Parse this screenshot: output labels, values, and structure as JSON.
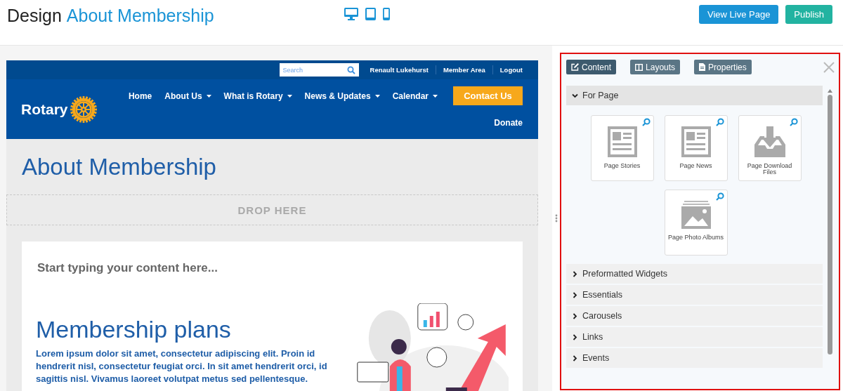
{
  "header": {
    "title_prefix": "Design",
    "title_page": "About Membership",
    "devices": [
      {
        "kind": "desktop"
      },
      {
        "kind": "tablet"
      },
      {
        "kind": "phone"
      }
    ],
    "buttons": [
      {
        "label": "View Live Page",
        "kind": "primary"
      },
      {
        "label": "Publish",
        "kind": "success"
      }
    ]
  },
  "preview": {
    "search": {
      "placeholder": "Search"
    },
    "top_links": [
      "Renault Lukehurst",
      "Member Area",
      "Logout"
    ],
    "logo": "Rotary",
    "nav": [
      {
        "label": "Home",
        "dropdown": false
      },
      {
        "label": "About Us",
        "dropdown": true
      },
      {
        "label": "What is Rotary",
        "dropdown": true
      },
      {
        "label": "News & Updates",
        "dropdown": true
      },
      {
        "label": "Calendar",
        "dropdown": true
      }
    ],
    "cta": "Contact Us",
    "donate": "Donate",
    "page_title": "About Membership",
    "drop_zone": "DROP HERE",
    "editor_placeholder": "Start typing your content here...",
    "heading": "Membership plans",
    "paragraph": "Lorem ipsum dolor sit amet, consectetur adipiscing elit. Proin id hendrerit nisl, consectetur feugiat orci. In sit amet hendrerit orci, id sagittis nisl. Vivamus laoreet volutpat metus sed pellentesque."
  },
  "panel": {
    "tabs": [
      {
        "label": "Content",
        "kind": "edit",
        "selected": true
      },
      {
        "label": "Layouts",
        "kind": "columns",
        "selected": false
      },
      {
        "label": "Properties",
        "kind": "file",
        "selected": false
      }
    ],
    "sections": [
      {
        "title": "For Page",
        "expanded": true,
        "widgets": [
          {
            "label": "Page Stories",
            "kind": "article"
          },
          {
            "label": "Page News",
            "kind": "article"
          },
          {
            "label": "Page Download Files",
            "kind": "download"
          },
          {
            "label": "Page Photo Albums"
          }
        ]
      },
      {
        "title": "Preformatted Widgets",
        "expanded": false
      },
      {
        "title": "Essentials",
        "expanded": false
      },
      {
        "title": "Carousels",
        "expanded": false
      },
      {
        "title": "Links",
        "expanded": false
      },
      {
        "title": "Events",
        "expanded": false
      }
    ]
  }
}
